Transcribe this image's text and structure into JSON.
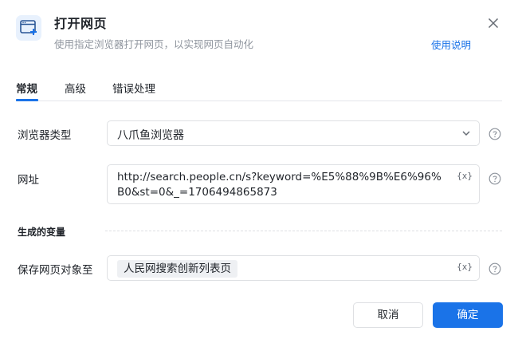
{
  "dialog": {
    "title": "打开网页",
    "subtitle": "使用指定浏览器打开网页，以实现网页自动化",
    "help_link": "使用说明",
    "icon": "browser-plus-icon",
    "accent_color": "#1a73e8"
  },
  "tabs": [
    {
      "label": "常规",
      "active": true
    },
    {
      "label": "高级",
      "active": false
    },
    {
      "label": "错误处理",
      "active": false
    }
  ],
  "form": {
    "browser_type": {
      "label": "浏览器类型",
      "value": "八爪鱼浏览器"
    },
    "url": {
      "label": "网址",
      "value": "http://search.people.cn/s?keyword=%E5%88%9B%E6%96%B0&st=0&_=1706494865873",
      "var_button": "{x}"
    },
    "section_title": "生成的变量",
    "save_target": {
      "label": "保存网页对象至",
      "value": "人民网搜索创新列表页",
      "var_button": "{x}"
    }
  },
  "footer": {
    "cancel_label": "取消",
    "ok_label": "确定"
  }
}
